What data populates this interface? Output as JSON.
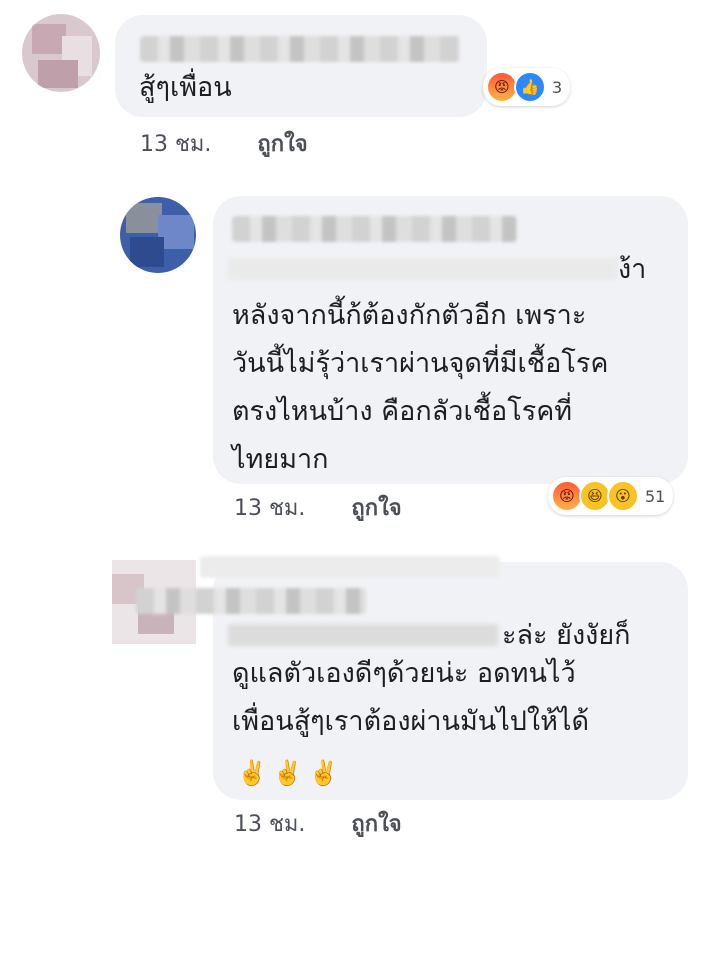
{
  "comments": [
    {
      "text": "สู้ๆเพื่อน",
      "time": "13 ชม.",
      "like_label": "ถูกใจ",
      "reactions": {
        "icons": [
          "angry-icon",
          "like-icon"
        ],
        "glyphs": [
          "😡",
          "👍"
        ],
        "count": "3"
      }
    },
    {
      "text_edge": "ง้า",
      "lines": [
        "หลังจากนี้ก้ต้องกักตัวอีก เพราะ",
        "วันนี้ไม่รุ้ว่าเราผ่านจุดที่มีเชื้อโรค",
        "ตรงไหนบ้าง คือกลัวเชื้อโรคที่",
        "ไทยมาก"
      ],
      "time": "13 ชม.",
      "like_label": "ถูกใจ",
      "reactions": {
        "icons": [
          "angry-icon",
          "haha-icon",
          "wow-icon"
        ],
        "glyphs": [
          "😡",
          "😆",
          "😮"
        ],
        "count": "51"
      }
    },
    {
      "text_edge": "ะล่ะ ยังงัยก็",
      "lines": [
        "ดูแลตัวเองดีๆด้วยน่ะ อดทนไว้",
        "เพื่อนสู้ๆเราต้องผ่านมันไปให้ได้"
      ],
      "emoji": "✌️✌️✌️",
      "time": "13 ชม.",
      "like_label": "ถูกใจ"
    }
  ],
  "colors": {
    "bubble": "#f0f2f5",
    "meta_text": "#4b4f56",
    "text": "#1c1e21"
  }
}
